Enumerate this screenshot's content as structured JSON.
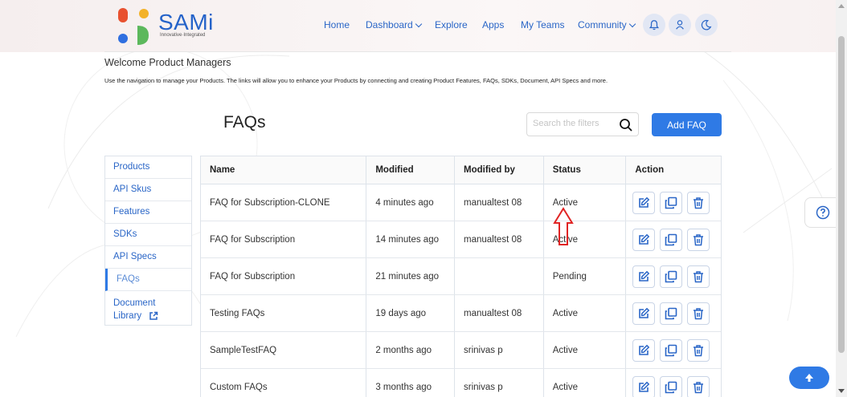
{
  "brand": {
    "name": "SAMi",
    "tagline": "Innovative·Integrated"
  },
  "nav": {
    "items": [
      {
        "label": "Home"
      },
      {
        "label": "Dashboard",
        "dropdown": true
      },
      {
        "label": "Explore"
      },
      {
        "label": "Apps"
      },
      {
        "label": "My Teams"
      },
      {
        "label": "Community",
        "dropdown": true
      }
    ],
    "icons": [
      "bell-icon",
      "user-icon",
      "moon-icon"
    ]
  },
  "welcome": {
    "title": "Welcome Product Managers",
    "text": "Use the navigation to manage your Products. The links will allow you to enhance your Products by connecting and creating Product Features, FAQs, SDKs, Document, API Specs and more."
  },
  "page": {
    "title": "FAQs",
    "search_placeholder": "Search the filters",
    "add_label": "Add FAQ"
  },
  "sidebar": {
    "items": [
      {
        "label": "Products"
      },
      {
        "label": "API Skus"
      },
      {
        "label": "Features"
      },
      {
        "label": "SDKs"
      },
      {
        "label": "API Specs"
      },
      {
        "label": "FAQs",
        "active": true
      },
      {
        "label": "Document Library",
        "external": true
      }
    ]
  },
  "table": {
    "headers": [
      "Name",
      "Modified",
      "Modified by",
      "Status",
      "Action"
    ],
    "rows": [
      {
        "name": "FAQ for Subscription-CLONE",
        "modified": "4 minutes ago",
        "modified_by": "manualtest 08",
        "status": "Active"
      },
      {
        "name": "FAQ for Subscription",
        "modified": "14 minutes ago",
        "modified_by": "manualtest 08",
        "status": "Active"
      },
      {
        "name": "FAQ for Subscription",
        "modified": "21 minutes ago",
        "modified_by": "",
        "status": "Pending"
      },
      {
        "name": "Testing FAQs",
        "modified": "19 days ago",
        "modified_by": "manualtest 08",
        "status": "Active"
      },
      {
        "name": "SampleTestFAQ",
        "modified": "2 months ago",
        "modified_by": "srinivas p",
        "status": "Active"
      },
      {
        "name": "Custom FAQs",
        "modified": "3 months ago",
        "modified_by": "srinivas p",
        "status": "Active"
      }
    ],
    "action_icons": [
      "edit-icon",
      "clone-icon",
      "delete-icon"
    ]
  },
  "colors": {
    "primary": "#2f7ae5",
    "link": "#2a66c7",
    "annotation": "#e02424"
  }
}
